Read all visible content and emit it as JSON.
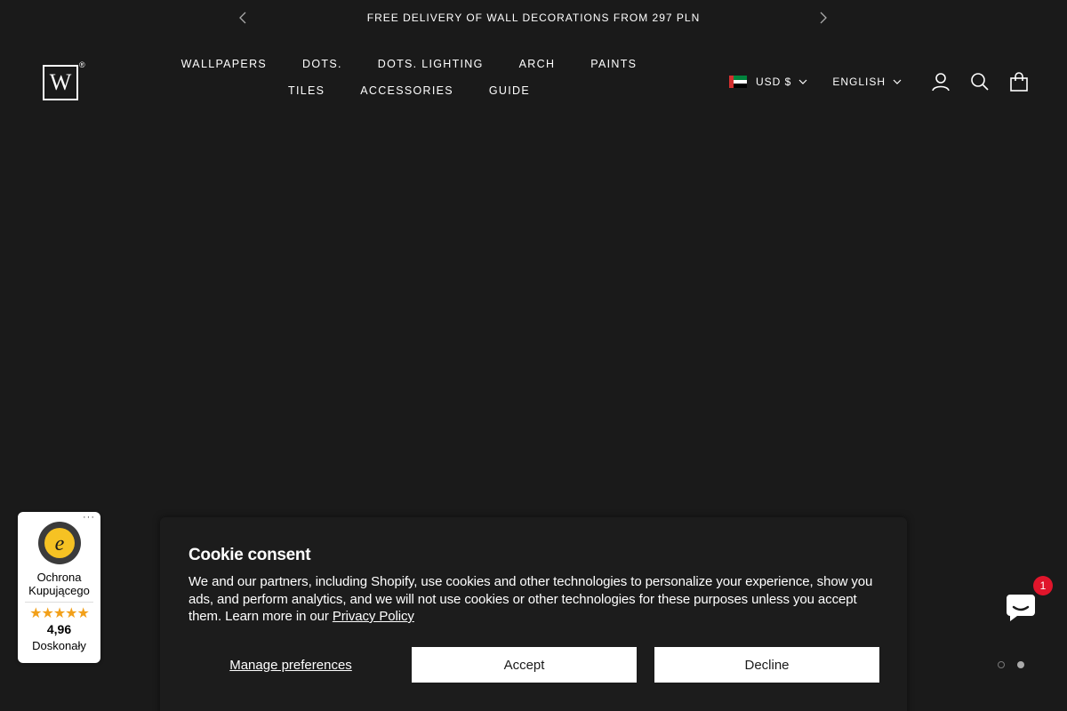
{
  "announcement": {
    "text": "FREE DELIVERY OF WALL DECORATIONS FROM 297 PLN",
    "prev_icon": "chevron-left-icon",
    "next_icon": "chevron-right-icon"
  },
  "header": {
    "logo_text": "W",
    "logo_mark": "®",
    "nav": [
      "WALLPAPERS",
      "DOTS.",
      "DOTS. LIGHTING",
      "ARCH",
      "PAINTS",
      "TILES",
      "ACCESSORIES",
      "GUIDE"
    ],
    "currency": "USD $",
    "language": "ENGLISH",
    "icons": [
      "account-icon",
      "search-icon",
      "cart-icon"
    ]
  },
  "trust_badge": {
    "title": "Ochrona Kupującego",
    "stars": "★★★★★",
    "score": "4,96",
    "verdict": "Doskonały",
    "more": "···"
  },
  "cookie": {
    "title": "Cookie consent",
    "body": "We and our partners, including Shopify, use cookies and other technologies to personalize your experience, show you ads, and perform analytics, and we will not use cookies or other technologies for these purposes unless you accept them. Learn more in our ",
    "link": "Privacy Policy",
    "manage": "Manage preferences",
    "accept": "Accept",
    "decline": "Decline"
  },
  "chat": {
    "badge": "1"
  },
  "colors": {
    "background": "#1a1a1a",
    "text": "#ffffff",
    "accent_red": "#e0152b",
    "star": "#f2a019"
  }
}
